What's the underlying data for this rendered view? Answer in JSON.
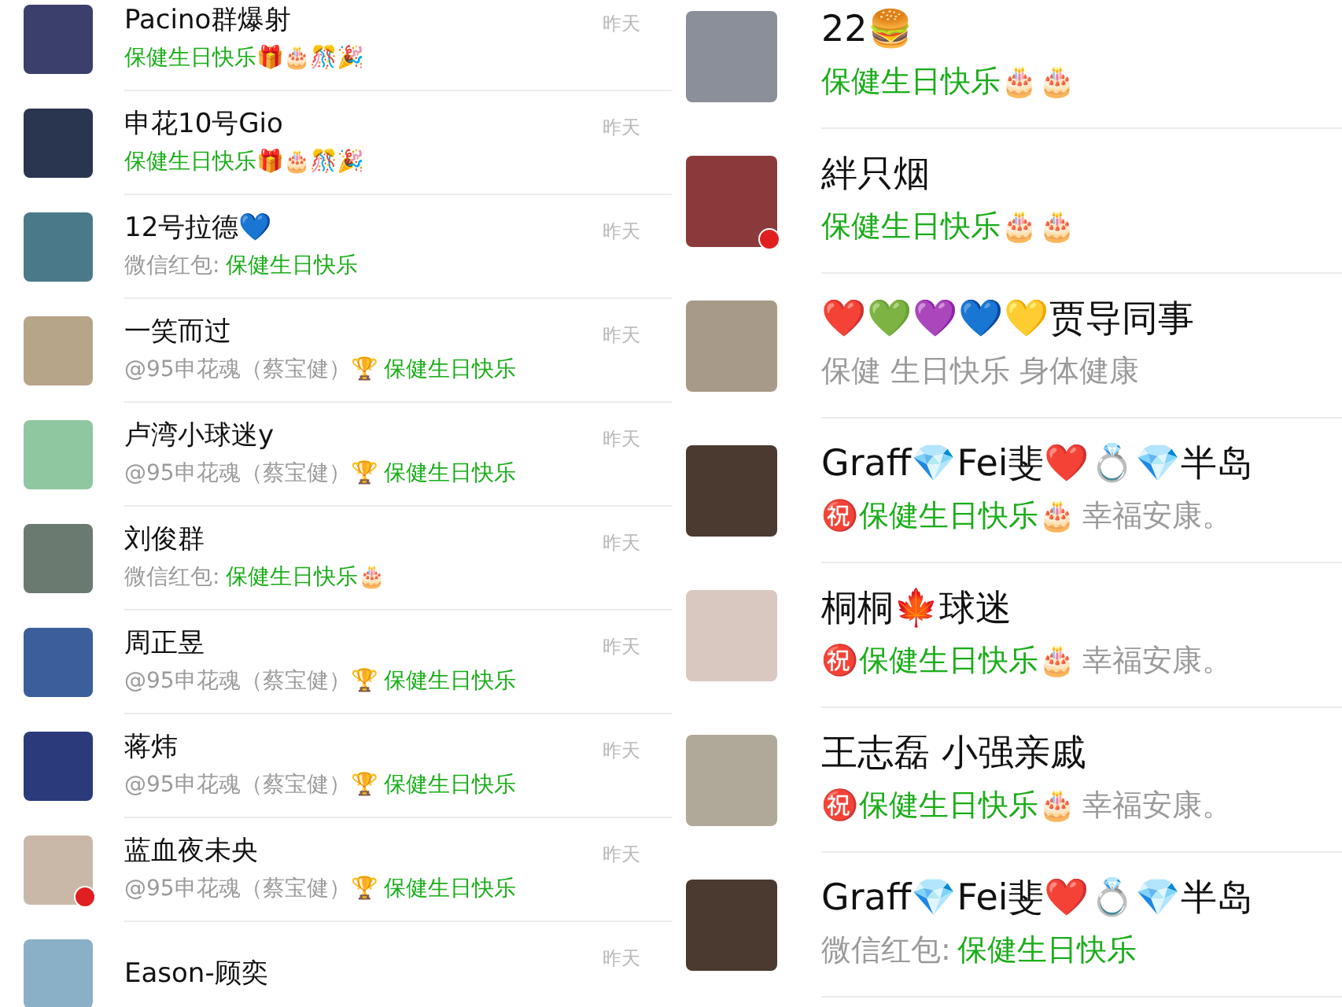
{
  "left_chats": [
    {
      "name": "Pacino群爆射",
      "time": "昨天",
      "flag_badge": false,
      "preview": [
        {
          "kind": "highlight",
          "text": "保健生日快乐🎁🎂🎊🎉"
        }
      ]
    },
    {
      "name": "申花10号Gio",
      "time": "昨天",
      "flag_badge": false,
      "preview": [
        {
          "kind": "highlight",
          "text": "保健生日快乐🎁🎂🎊🎉"
        }
      ]
    },
    {
      "name": "12号拉德💙",
      "time": "昨天",
      "flag_badge": false,
      "preview": [
        {
          "kind": "plain",
          "text": "微信红包:"
        },
        {
          "kind": "highlight",
          "text": "保健生日快乐"
        }
      ]
    },
    {
      "name": "一笑而过",
      "time": "昨天",
      "flag_badge": false,
      "preview": [
        {
          "kind": "plain",
          "text": "@95申花魂（蔡宝健）🏆"
        },
        {
          "kind": "highlight",
          "text": "保健生日快乐"
        }
      ]
    },
    {
      "name": "卢湾小球迷y",
      "time": "昨天",
      "flag_badge": false,
      "preview": [
        {
          "kind": "plain",
          "text": "@95申花魂（蔡宝健）🏆"
        },
        {
          "kind": "highlight",
          "text": "保健生日快乐"
        }
      ]
    },
    {
      "name": "刘俊群",
      "time": "昨天",
      "flag_badge": false,
      "preview": [
        {
          "kind": "plain",
          "text": "微信红包:"
        },
        {
          "kind": "highlight",
          "text": "保健生日快乐🎂"
        }
      ]
    },
    {
      "name": "周正昱",
      "time": "昨天",
      "flag_badge": false,
      "preview": [
        {
          "kind": "plain",
          "text": "@95申花魂（蔡宝健）🏆"
        },
        {
          "kind": "highlight",
          "text": "保健生日快乐"
        }
      ]
    },
    {
      "name": "蒋炜",
      "time": "昨天",
      "flag_badge": false,
      "preview": [
        {
          "kind": "plain",
          "text": "@95申花魂（蔡宝健）🏆"
        },
        {
          "kind": "highlight",
          "text": "保健生日快乐"
        }
      ]
    },
    {
      "name": "蓝血夜未央",
      "time": "昨天",
      "flag_badge": true,
      "preview": [
        {
          "kind": "plain",
          "text": "@95申花魂（蔡宝健）🏆"
        },
        {
          "kind": "highlight",
          "text": "保健生日快乐"
        }
      ]
    },
    {
      "name": "Eason-顾奕",
      "time": "昨天",
      "flag_badge": false
    }
  ],
  "right_chats": [
    {
      "name": "22🍔",
      "flag_badge": false,
      "preview": [
        {
          "kind": "highlight",
          "text": "保健生日快乐🎂🎂"
        }
      ]
    },
    {
      "name": "絆只烟",
      "flag_badge": true,
      "preview": [
        {
          "kind": "highlight",
          "text": "保健生日快乐🎂🎂"
        }
      ]
    },
    {
      "name": "❤️💚💜💙💛贾导同事",
      "flag_badge": false,
      "preview": [
        {
          "kind": "plain",
          "text": "保健 生日快乐 身体健康"
        }
      ]
    },
    {
      "name": "Graff💎Fei斐❤️💍💎半岛",
      "flag_badge": false,
      "preview": [
        {
          "kind": "highlight",
          "text": "㊗️保健生日快乐🎂"
        },
        {
          "kind": "plain",
          "text": "幸福安康。"
        }
      ]
    },
    {
      "name": "桐桐🍁球迷",
      "flag_badge": false,
      "preview": [
        {
          "kind": "highlight",
          "text": "㊗️保健生日快乐🎂"
        },
        {
          "kind": "plain",
          "text": "幸福安康。"
        }
      ]
    },
    {
      "name": "王志磊 小强亲戚",
      "flag_badge": false,
      "preview": [
        {
          "kind": "highlight",
          "text": "㊗️保健生日快乐🎂"
        },
        {
          "kind": "plain",
          "text": "幸福安康。"
        }
      ]
    },
    {
      "name": "Graff💎Fei斐❤️💍💎半岛",
      "flag_badge": false,
      "preview": [
        {
          "kind": "plain",
          "text": "微信红包:"
        },
        {
          "kind": "highlight",
          "text": "保健生日快乐"
        }
      ]
    }
  ]
}
